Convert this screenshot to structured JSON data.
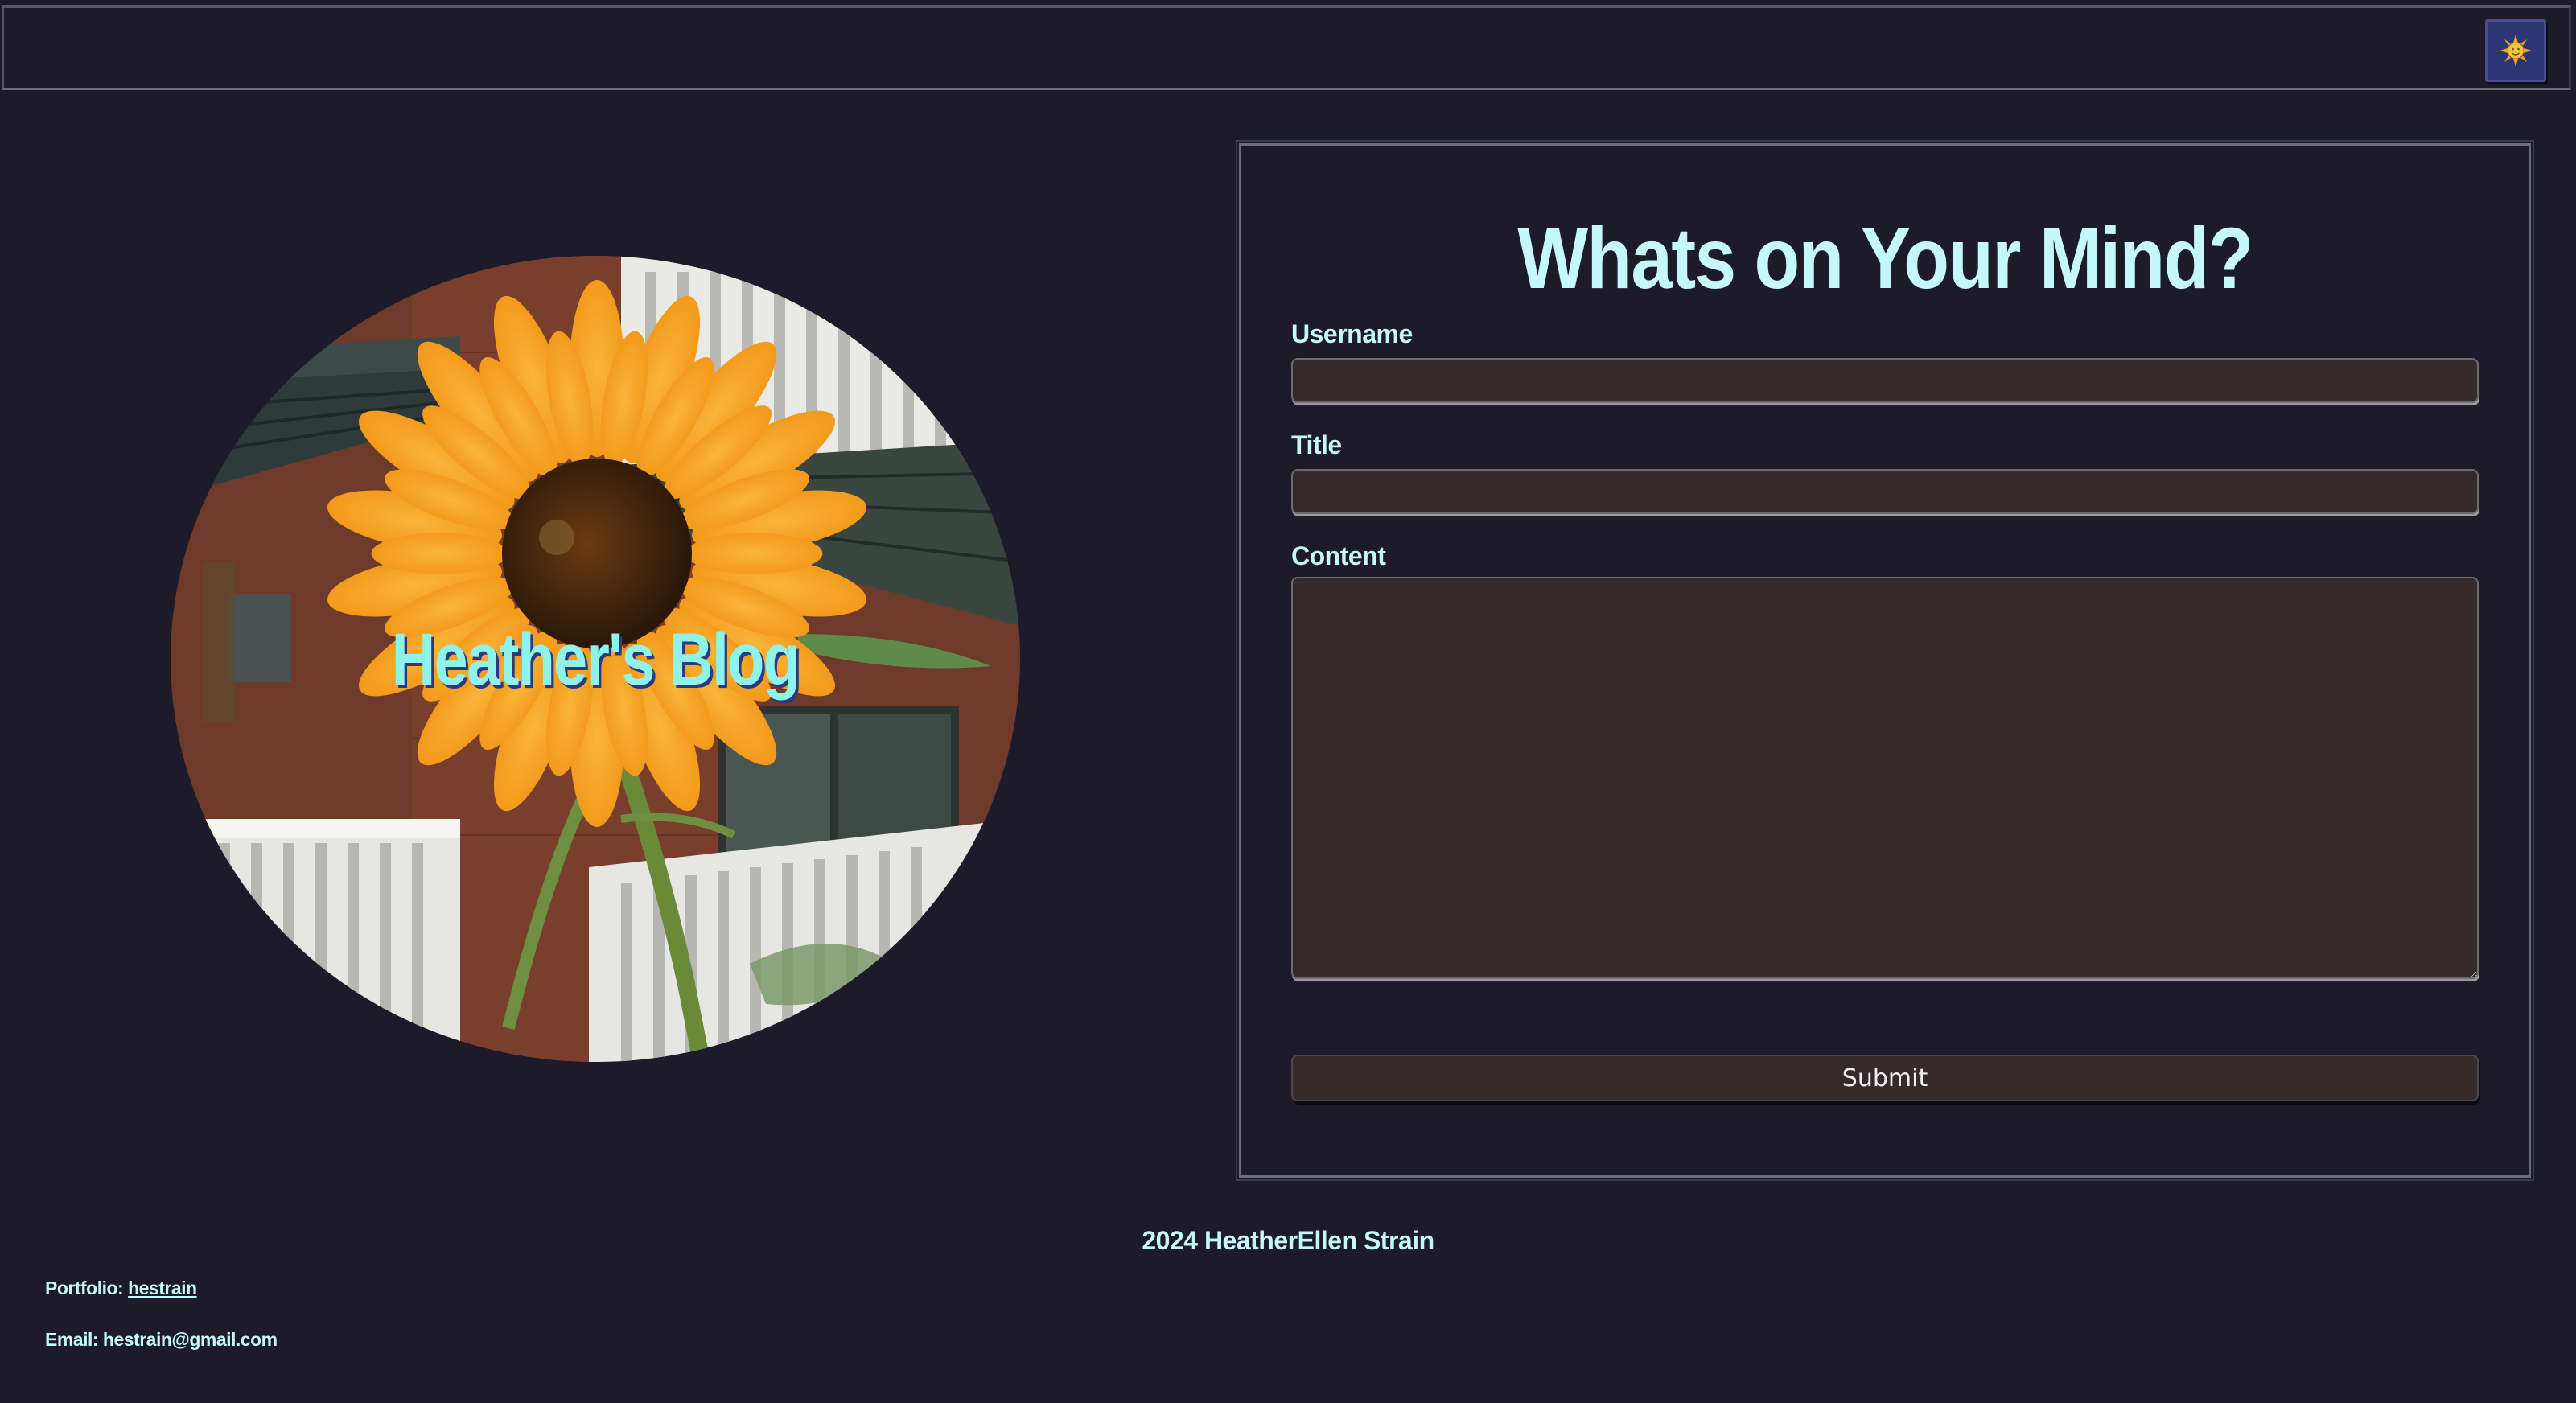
{
  "header": {
    "theme_toggle_icon": "sun-icon"
  },
  "hero": {
    "blog_title": "Heather's Blog",
    "image_subject": "sunflower-photo"
  },
  "form": {
    "heading": "Whats on Your Mind?",
    "username_label": "Username",
    "username_value": "",
    "title_label": "Title",
    "title_value": "",
    "content_label": "Content",
    "content_value": "",
    "submit_label": "Submit"
  },
  "footer": {
    "copyright": "2024 HeatherEllen Strain",
    "portfolio_prefix": "Portfolio: ",
    "portfolio_link": "hestrain",
    "email_line": "Email: hestrain@gmail.com"
  },
  "colors": {
    "background": "#1d1a2a",
    "accent_text": "#c4f8fb",
    "title_text": "#8ff3ec",
    "input_bg": "#352b2c",
    "toggle_bg": "#2e3574"
  }
}
